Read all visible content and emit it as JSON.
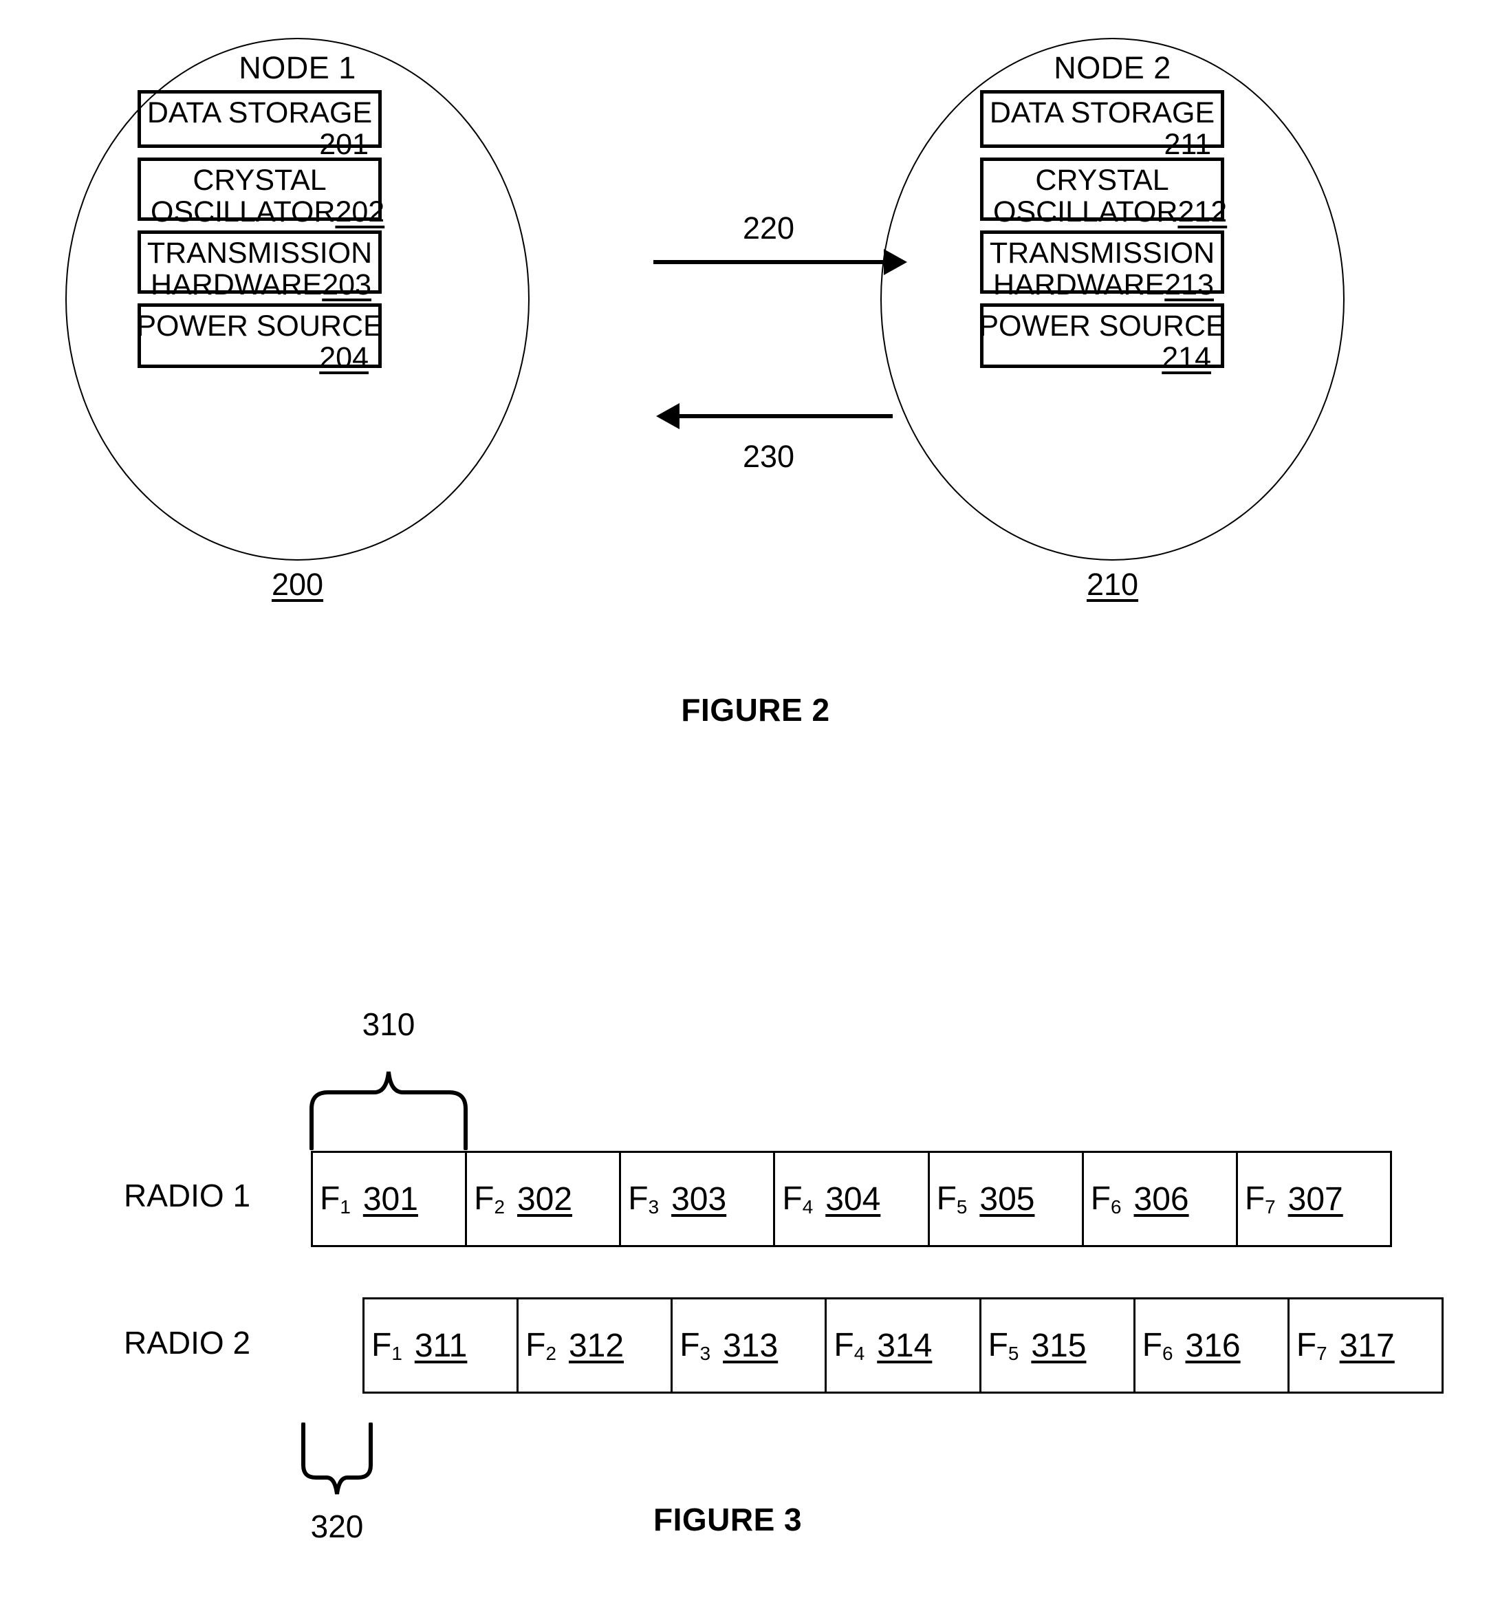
{
  "figure2": {
    "caption": "FIGURE 2",
    "nodes": [
      {
        "title": "NODE 1",
        "id_label": "200",
        "components": [
          {
            "line1": "DATA STORAGE",
            "line2": "",
            "num": "201",
            "layout": "stacked"
          },
          {
            "line1": "CRYSTAL",
            "line2": "OSCILLATOR",
            "num": "202",
            "layout": "twoline"
          },
          {
            "line1": "TRANSMISSION",
            "line2": "HARDWARE",
            "num": "203",
            "layout": "twoline"
          },
          {
            "line1": "POWER SOURCE",
            "line2": "",
            "num": "204",
            "layout": "stacked"
          }
        ]
      },
      {
        "title": "NODE 2",
        "id_label": "210",
        "components": [
          {
            "line1": "DATA STORAGE",
            "line2": "",
            "num": "211",
            "layout": "stacked"
          },
          {
            "line1": "CRYSTAL",
            "line2": "OSCILLATOR",
            "num": "212",
            "layout": "twoline"
          },
          {
            "line1": "TRANSMISSION",
            "line2": "HARDWARE",
            "num": "213",
            "layout": "twoline"
          },
          {
            "line1": "POWER SOURCE",
            "line2": "",
            "num": "214",
            "layout": "stacked"
          }
        ]
      }
    ],
    "arrows": [
      {
        "label": "220",
        "direction": "right"
      },
      {
        "label": "230",
        "direction": "left"
      }
    ]
  },
  "figure3": {
    "caption": "FIGURE 3",
    "brace_top_label": "310",
    "brace_bottom_label": "320",
    "rows": [
      {
        "label": "RADIO 1",
        "cells": [
          {
            "freq": "F",
            "sub": "1",
            "num": "301"
          },
          {
            "freq": "F",
            "sub": "2",
            "num": "302"
          },
          {
            "freq": "F",
            "sub": "3",
            "num": "303"
          },
          {
            "freq": "F",
            "sub": "4",
            "num": "304"
          },
          {
            "freq": "F",
            "sub": "5",
            "num": "305"
          },
          {
            "freq": "F",
            "sub": "6",
            "num": "306"
          },
          {
            "freq": "F",
            "sub": "7",
            "num": "307"
          }
        ]
      },
      {
        "label": "RADIO 2",
        "cells": [
          {
            "freq": "F",
            "sub": "1",
            "num": "311"
          },
          {
            "freq": "F",
            "sub": "2",
            "num": "312"
          },
          {
            "freq": "F",
            "sub": "3",
            "num": "313"
          },
          {
            "freq": "F",
            "sub": "4",
            "num": "314"
          },
          {
            "freq": "F",
            "sub": "5",
            "num": "315"
          },
          {
            "freq": "F",
            "sub": "6",
            "num": "316"
          },
          {
            "freq": "F",
            "sub": "7",
            "num": "317"
          }
        ]
      }
    ]
  },
  "colors": {
    "ink": "#000000",
    "paper": "#ffffff"
  }
}
